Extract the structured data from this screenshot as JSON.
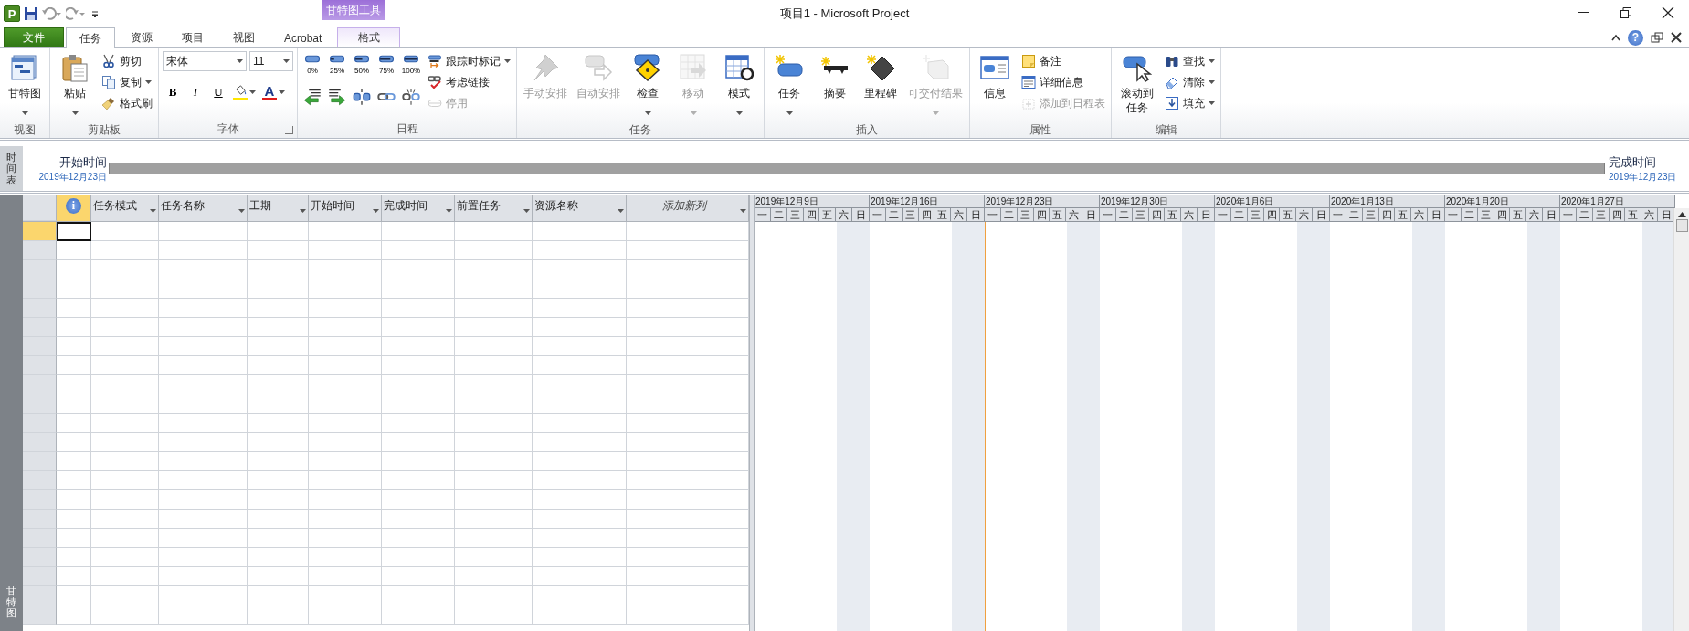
{
  "app_logo": "P",
  "window": {
    "title": "项目1  -  Microsoft Project"
  },
  "contextual_group": "甘特图工具",
  "help": "?",
  "tabs": [
    {
      "label": "文件",
      "kind": "file",
      "selected": false
    },
    {
      "label": "任务",
      "kind": "normal",
      "selected": true
    },
    {
      "label": "资源",
      "kind": "normal",
      "selected": false
    },
    {
      "label": "项目",
      "kind": "normal",
      "selected": false
    },
    {
      "label": "视图",
      "kind": "normal",
      "selected": false
    },
    {
      "label": "Acrobat",
      "kind": "normal",
      "selected": false
    },
    {
      "label": "格式",
      "kind": "contextual",
      "selected": false
    }
  ],
  "ribbon_groups": [
    {
      "label": "视图",
      "columns": [
        [
          {
            "kind": "large",
            "label": "甘特图",
            "dropdown": true,
            "disabled": false
          }
        ]
      ]
    },
    {
      "label": "剪贴板",
      "columns": [
        [
          {
            "kind": "large",
            "label": "粘贴",
            "dropdown": true,
            "disabled": false
          }
        ],
        [
          {
            "kind": "small",
            "label": "剪切",
            "dropdown": false,
            "disabled": false
          },
          {
            "kind": "small",
            "label": "复制",
            "dropdown": true,
            "disabled": false
          },
          {
            "kind": "small",
            "label": "格式刷",
            "dropdown": false,
            "disabled": false
          }
        ]
      ]
    },
    {
      "label": "字体",
      "launcher": true,
      "columns": [
        [
          {
            "kind": "row",
            "items": [
              {
                "kind": "combo",
                "value": "宋体"
              },
              {
                "kind": "combo",
                "value": "11"
              }
            ]
          },
          {
            "kind": "row",
            "items": [
              {
                "kind": "format",
                "label": "B"
              },
              {
                "kind": "format",
                "label": "I"
              },
              {
                "kind": "format",
                "label": "U"
              },
              {
                "kind": "fill",
                "color": "#ffe600"
              },
              {
                "kind": "fontcolor",
                "label": "A",
                "color": "#e01b1b"
              }
            ]
          }
        ]
      ]
    },
    {
      "label": "日程",
      "columns": [
        [
          {
            "kind": "row",
            "items": [
              {
                "kind": "percent",
                "label": "0%"
              },
              {
                "kind": "percent",
                "label": "25%"
              },
              {
                "kind": "percent",
                "label": "50%"
              },
              {
                "kind": "percent",
                "label": "75%"
              },
              {
                "kind": "percent",
                "label": "100%"
              }
            ]
          },
          {
            "kind": "row",
            "items": [
              {
                "kind": "icon",
                "disabled": false
              },
              {
                "kind": "icon",
                "disabled": false
              },
              {
                "kind": "icon",
                "disabled": false
              },
              {
                "kind": "icon",
                "disabled": false
              },
              {
                "kind": "icon",
                "disabled": false
              }
            ]
          }
        ],
        [
          {
            "kind": "small",
            "label": "跟踪时标记",
            "dropdown": true,
            "disabled": false
          },
          {
            "kind": "small",
            "label": "考虑链接",
            "dropdown": false,
            "disabled": false
          },
          {
            "kind": "small",
            "label": "停用",
            "dropdown": false,
            "disabled": true
          }
        ]
      ]
    },
    {
      "label": "任务",
      "columns": [
        [
          {
            "kind": "large",
            "label": "手动安排",
            "dropdown": false,
            "disabled": true
          }
        ],
        [
          {
            "kind": "large",
            "label": "自动安排",
            "dropdown": false,
            "disabled": true
          }
        ],
        [
          {
            "kind": "large",
            "label": "检查",
            "dropdown": true,
            "disabled": false
          }
        ],
        [
          {
            "kind": "large",
            "label": "移动",
            "dropdown": true,
            "disabled": true
          }
        ],
        [
          {
            "kind": "large",
            "label": "模式",
            "dropdown": true,
            "disabled": false
          }
        ]
      ]
    },
    {
      "label": "插入",
      "columns": [
        [
          {
            "kind": "large",
            "label": "任务",
            "dropdown": true,
            "disabled": false
          }
        ],
        [
          {
            "kind": "large",
            "label": "摘要",
            "dropdown": false,
            "disabled": false
          }
        ],
        [
          {
            "kind": "large",
            "label": "里程碑",
            "dropdown": false,
            "disabled": false
          }
        ],
        [
          {
            "kind": "large",
            "label": "可交付结果",
            "dropdown": true,
            "disabled": true
          }
        ]
      ]
    },
    {
      "label": "属性",
      "columns": [
        [
          {
            "kind": "large",
            "label": "信息",
            "dropdown": false,
            "disabled": false
          }
        ],
        [
          {
            "kind": "small",
            "label": "备注",
            "dropdown": false,
            "disabled": false
          },
          {
            "kind": "small",
            "label": "详细信息",
            "dropdown": false,
            "disabled": false
          },
          {
            "kind": "small",
            "label": "添加到日程表",
            "dropdown": false,
            "disabled": true
          }
        ]
      ]
    },
    {
      "label": "编辑",
      "columns": [
        [
          {
            "kind": "large",
            "label": "滚动到任务",
            "dropdown": false,
            "disabled": false
          }
        ],
        [
          {
            "kind": "small",
            "label": "查找",
            "dropdown": true,
            "disabled": false
          },
          {
            "kind": "small",
            "label": "清除",
            "dropdown": true,
            "disabled": false
          },
          {
            "kind": "small",
            "label": "填充",
            "dropdown": true,
            "disabled": false
          }
        ]
      ]
    }
  ],
  "timeline": {
    "side_label": "时间表",
    "start_label": "开始时间",
    "start_date": "2019年12月23日",
    "finish_label": "完成时间",
    "finish_date": "2019年12月23日"
  },
  "table": {
    "side_label": "甘特图",
    "indicator": "i",
    "columns": [
      {
        "kind": "indicator",
        "dropdown": false
      },
      {
        "kind": "normal",
        "label": "任务模式",
        "dropdown": true
      },
      {
        "kind": "normal",
        "label": "任务名称",
        "dropdown": true
      },
      {
        "kind": "normal",
        "label": "工期",
        "dropdown": true
      },
      {
        "kind": "normal",
        "label": "开始时间",
        "dropdown": true
      },
      {
        "kind": "normal",
        "label": "完成时间",
        "dropdown": true
      },
      {
        "kind": "normal",
        "label": "前置任务",
        "dropdown": true
      },
      {
        "kind": "normal",
        "label": "资源名称",
        "dropdown": true
      },
      {
        "kind": "add",
        "label": "添加新列",
        "dropdown": true
      }
    ],
    "rows": [
      {
        "selected": true
      },
      {
        "selected": false
      },
      {
        "selected": false
      },
      {
        "selected": false
      },
      {
        "selected": false
      },
      {
        "selected": false
      },
      {
        "selected": false
      },
      {
        "selected": false
      },
      {
        "selected": false
      },
      {
        "selected": false
      },
      {
        "selected": false
      },
      {
        "selected": false
      },
      {
        "selected": false
      },
      {
        "selected": false
      },
      {
        "selected": false
      },
      {
        "selected": false
      },
      {
        "selected": false
      },
      {
        "selected": false
      },
      {
        "selected": false
      },
      {
        "selected": false
      },
      {
        "selected": false
      }
    ]
  },
  "gantt": {
    "weeks": [
      {
        "label": "2019年12月9日",
        "days": [
          {
            "label": "一"
          },
          {
            "label": "二"
          },
          {
            "label": "三"
          },
          {
            "label": "四"
          },
          {
            "label": "五"
          },
          {
            "label": "六",
            "weekend": true
          },
          {
            "label": "日",
            "weekend": true
          }
        ]
      },
      {
        "label": "2019年12月16日",
        "days": [
          {
            "label": "一"
          },
          {
            "label": "二"
          },
          {
            "label": "三"
          },
          {
            "label": "四"
          },
          {
            "label": "五"
          },
          {
            "label": "六",
            "weekend": true
          },
          {
            "label": "日",
            "weekend": true
          }
        ]
      },
      {
        "label": "2019年12月23日",
        "days": [
          {
            "label": "一",
            "today": true
          },
          {
            "label": "二"
          },
          {
            "label": "三"
          },
          {
            "label": "四"
          },
          {
            "label": "五"
          },
          {
            "label": "六",
            "weekend": true
          },
          {
            "label": "日",
            "weekend": true
          }
        ]
      },
      {
        "label": "2019年12月30日",
        "days": [
          {
            "label": "一"
          },
          {
            "label": "二"
          },
          {
            "label": "三"
          },
          {
            "label": "四"
          },
          {
            "label": "五"
          },
          {
            "label": "六",
            "weekend": true
          },
          {
            "label": "日",
            "weekend": true
          }
        ]
      },
      {
        "label": "2020年1月6日",
        "days": [
          {
            "label": "一"
          },
          {
            "label": "二"
          },
          {
            "label": "三"
          },
          {
            "label": "四"
          },
          {
            "label": "五"
          },
          {
            "label": "六",
            "weekend": true
          },
          {
            "label": "日",
            "weekend": true
          }
        ]
      },
      {
        "label": "2020年1月13日",
        "days": [
          {
            "label": "一"
          },
          {
            "label": "二"
          },
          {
            "label": "三"
          },
          {
            "label": "四"
          },
          {
            "label": "五"
          },
          {
            "label": "六",
            "weekend": true
          },
          {
            "label": "日",
            "weekend": true
          }
        ]
      },
      {
        "label": "2020年1月20日",
        "days": [
          {
            "label": "一"
          },
          {
            "label": "二"
          },
          {
            "label": "三"
          },
          {
            "label": "四"
          },
          {
            "label": "五"
          },
          {
            "label": "六",
            "weekend": true
          },
          {
            "label": "日",
            "weekend": true
          }
        ]
      },
      {
        "label": "2020年1月27日",
        "days": [
          {
            "label": "一"
          },
          {
            "label": "二"
          },
          {
            "label": "三"
          },
          {
            "label": "四"
          },
          {
            "label": "五"
          },
          {
            "label": "六",
            "weekend": true
          },
          {
            "label": "日",
            "weekend": true
          }
        ]
      }
    ]
  }
}
